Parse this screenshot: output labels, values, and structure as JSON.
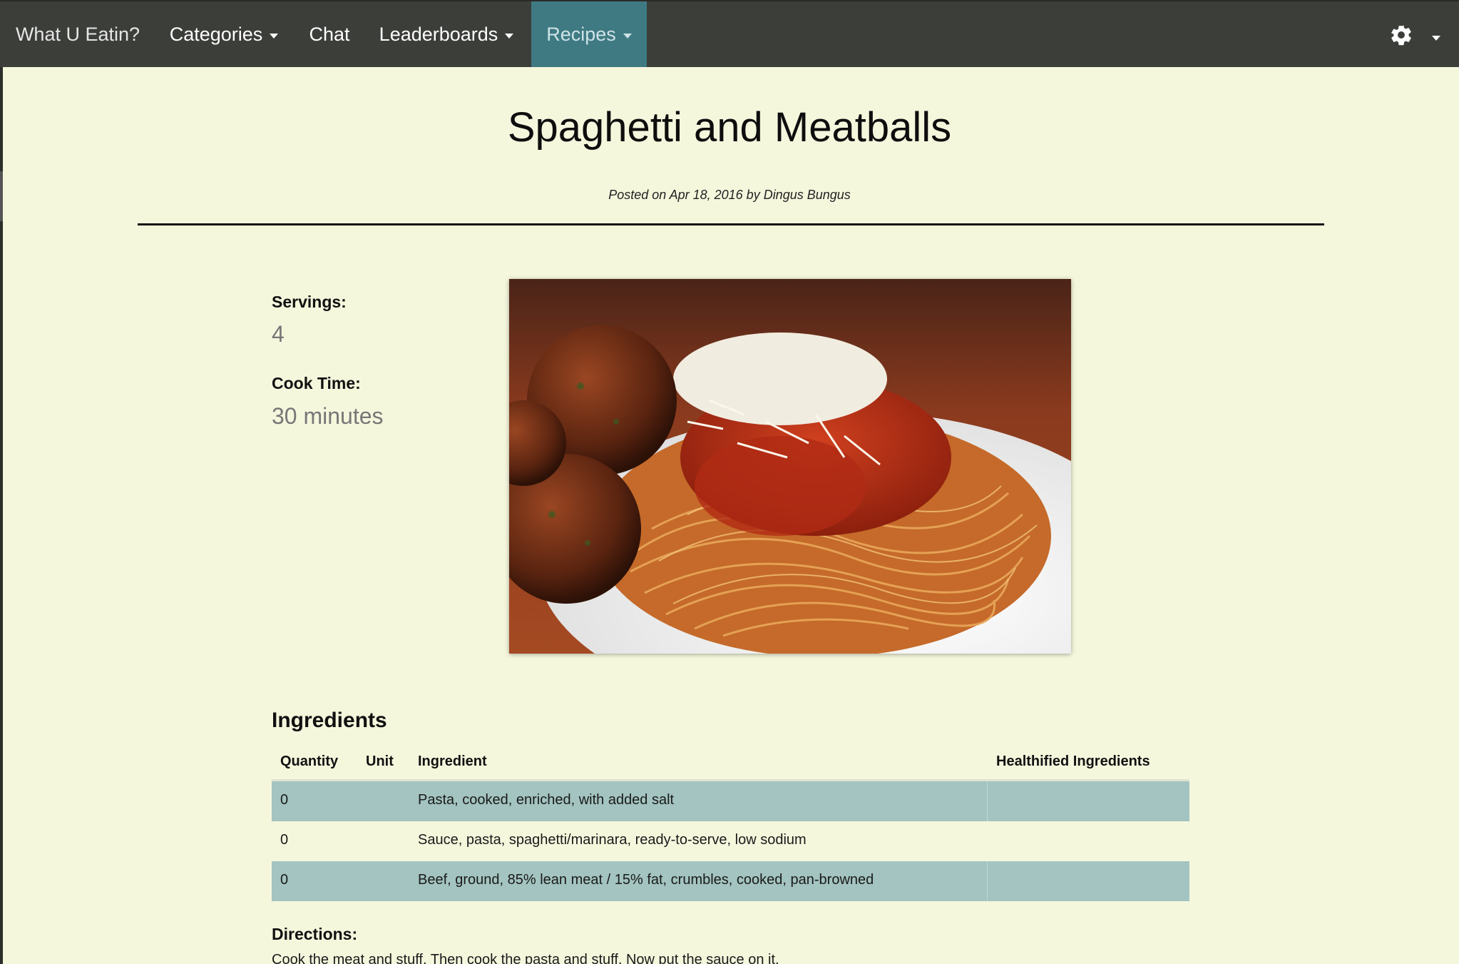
{
  "navbar": {
    "brand": "What U Eatin?",
    "items": [
      {
        "label": "Categories"
      },
      {
        "label": "Chat"
      },
      {
        "label": "Leaderboards"
      },
      {
        "label": "Recipes"
      }
    ],
    "active_item": "Recipes",
    "icons": [
      "gear-icon",
      "chevron-down-icon"
    ]
  },
  "recipe": {
    "title": "Spaghetti and Meatballs",
    "posted": "Posted on Apr 18, 2016 by Dingus Bungus",
    "servings_label": "Servings:",
    "servings_value": "4",
    "cook_time_label": "Cook Time:",
    "cook_time_value": "30 minutes"
  },
  "ingredients": {
    "title": "Ingredients",
    "headers": {
      "quantity": "Quantity",
      "unit": "Unit",
      "ingredient": "Ingredient",
      "healthified": "Healthified Ingredients"
    },
    "rows": [
      {
        "quantity": "0",
        "unit": "",
        "ingredient": "Pasta, cooked, enriched, with added salt",
        "healthified": ""
      },
      {
        "quantity": "0",
        "unit": "",
        "ingredient": "Sauce, pasta, spaghetti/marinara, ready-to-serve, low sodium",
        "healthified": ""
      },
      {
        "quantity": "0",
        "unit": "",
        "ingredient": "Beef, ground, 85% lean meat / 15% fat, crumbles, cooked, pan-browned",
        "healthified": ""
      }
    ]
  },
  "directions": {
    "label": "Directions:",
    "text": "Cook the meat and stuff. Then cook the pasta and stuff. Now put the sauce on it."
  },
  "colors": {
    "navbar_bg": "#3c3e3a",
    "active_tab_bg": "#3f7a83",
    "page_bg": "#f5f7dd",
    "row_alt_bg": "#a3c4c1"
  }
}
